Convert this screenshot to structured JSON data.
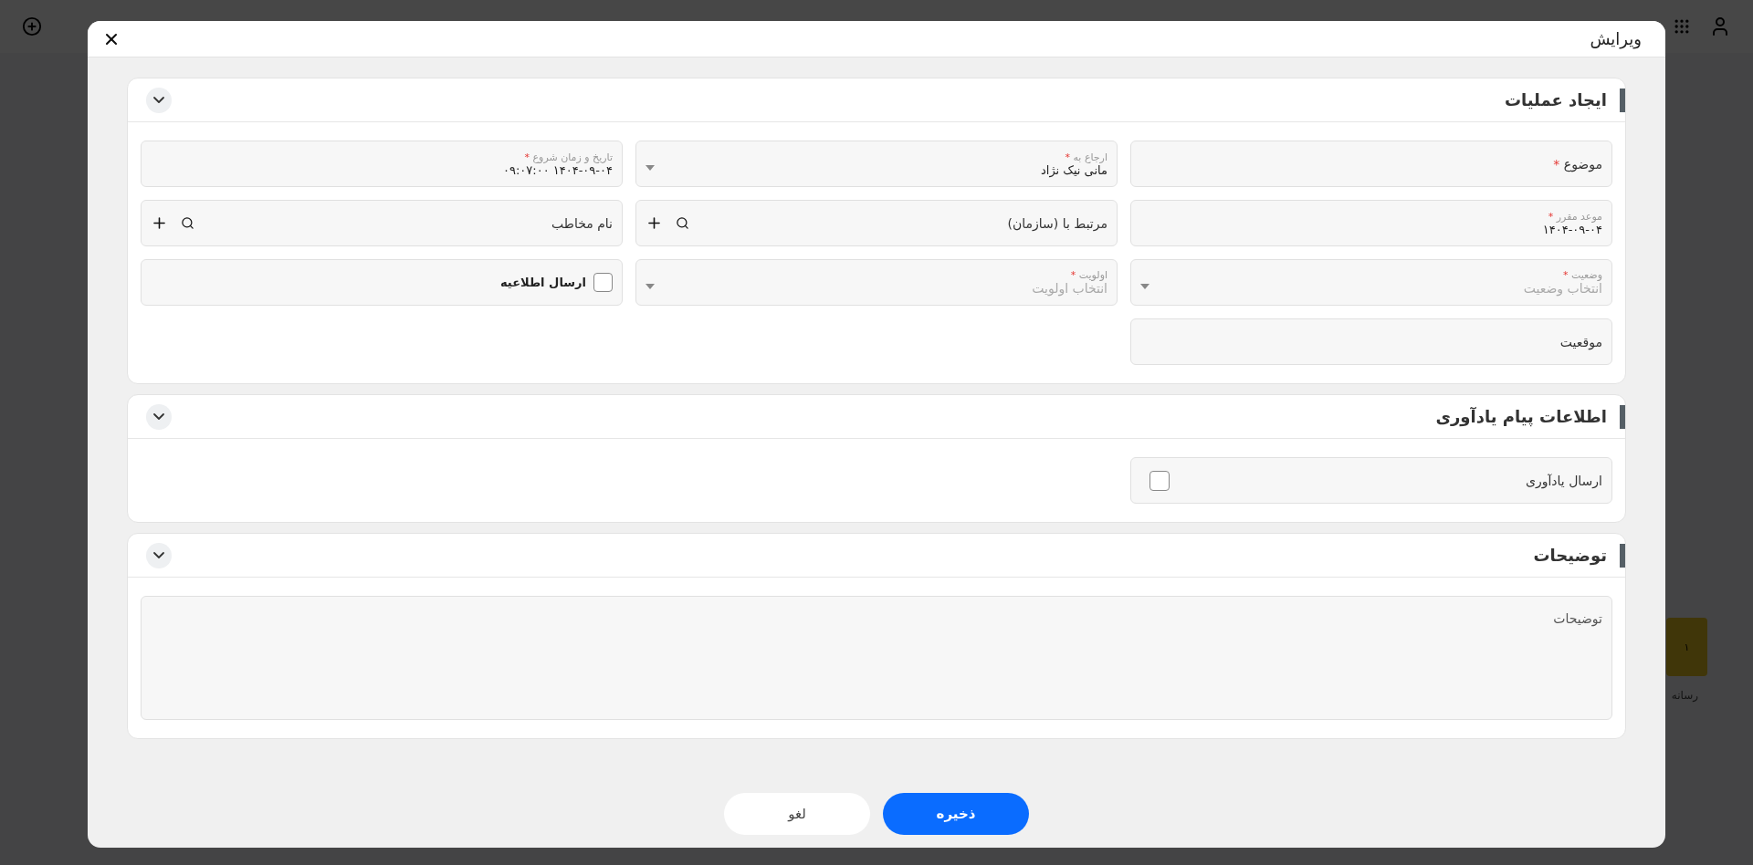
{
  "background": {
    "axis_label": "رسانه",
    "bar_value": "۱"
  },
  "dialog": {
    "title": "ویرایش",
    "sections": [
      {
        "title": "ایجاد عملیات",
        "expanded": true,
        "fields": [
          {
            "kind": "text",
            "label": "موضوع",
            "required_mark": "*"
          },
          {
            "kind": "select",
            "label": "ارجاع به",
            "required_mark": "*",
            "value": "مانی نیک نژاد"
          },
          {
            "kind": "text",
            "label": "تاریخ و زمان شروع",
            "required_mark": "*",
            "value": "۱۴۰۴-۰۹-۰۴ ۰۹:۰۷:۰۰"
          },
          {
            "kind": "text",
            "label": "موعد مقرر",
            "required_mark": "*",
            "value": "۱۴۰۴-۰۹-۰۴"
          },
          {
            "kind": "lookup",
            "label": "مرتبط با (سازمان)"
          },
          {
            "kind": "lookup",
            "label": "نام مخاطب"
          },
          {
            "kind": "select",
            "label": "وضعیت",
            "required_mark": "*",
            "placeholder": "انتخاب وضعیت"
          },
          {
            "kind": "select",
            "label": "اولویت",
            "required_mark": "*",
            "placeholder": "انتخاب اولویت"
          },
          {
            "kind": "checkbox",
            "label": "ارسال اطلاعیه",
            "checked": false
          },
          {
            "kind": "text",
            "label": "موقعیت"
          }
        ]
      },
      {
        "title": "اطلاعات پیام یادآوری",
        "expanded": true,
        "fields": [
          {
            "kind": "toggle",
            "label": "ارسال یادآوری",
            "checked": false
          }
        ]
      },
      {
        "title": "توضیحات",
        "expanded": true,
        "fields": [
          {
            "kind": "textarea",
            "placeholder": "توضیحات"
          }
        ]
      }
    ],
    "buttons": [
      {
        "label": "ذخیره",
        "primary": true
      },
      {
        "label": "لغو",
        "primary": false
      }
    ]
  }
}
